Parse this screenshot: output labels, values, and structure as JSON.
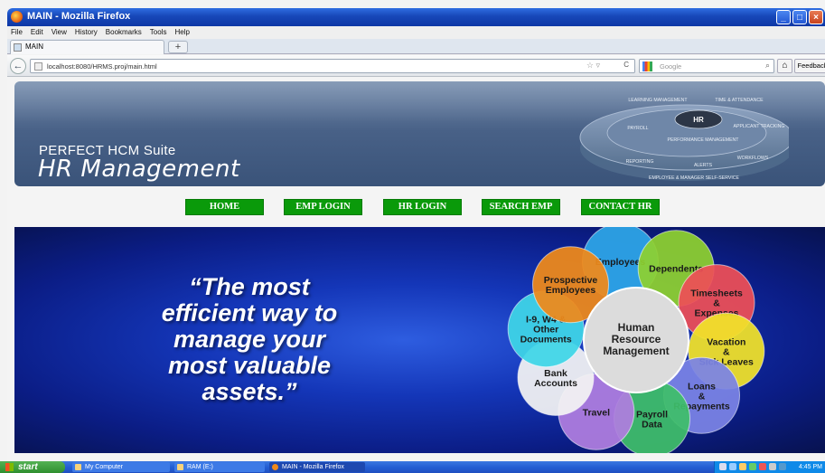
{
  "window": {
    "title": "MAIN - Mozilla Firefox",
    "controls": {
      "minimize": "_",
      "maximize": "□",
      "close": "×"
    }
  },
  "menubar": [
    "File",
    "Edit",
    "View",
    "History",
    "Bookmarks",
    "Tools",
    "Help"
  ],
  "tabs": [
    {
      "label": "MAIN"
    }
  ],
  "newtab_label": "+",
  "navbar": {
    "back": "←",
    "url": "localhost:8080/HRMS.proj/main.html",
    "star": "☆ ▿",
    "reload": "C",
    "search_placeholder": "Google",
    "search_icon": "⌕",
    "home": "⌂",
    "feedback": "Feedback"
  },
  "banner": {
    "suite": "PERFECT HCM Suite",
    "title": "HR Management",
    "wheel": {
      "center": "HR",
      "segments": [
        "LEARNING MANAGEMENT",
        "TIME & ATTENDANCE",
        "PAYROLL",
        "APPLICANT TRACKING",
        "PERFORMANCE MANAGEMENT",
        "REPORTING",
        "ALERTS",
        "WORKFLOWS",
        "EMPLOYEE & MANAGER SELF-SERVICE"
      ]
    }
  },
  "nav_menu": [
    "HOME",
    "EMP LOGIN",
    "HR LOGIN",
    "SEARCH EMP",
    "CONTACT HR"
  ],
  "hero": {
    "quote_lines": [
      "“The most",
      "efficient way to",
      "manage your",
      "most valuable",
      "assets.”"
    ]
  },
  "diagram": {
    "center_lines": [
      "Human",
      "Resource",
      "Management"
    ],
    "petals": [
      {
        "lines": [
          "Employees"
        ],
        "color": "#2ea6e8"
      },
      {
        "lines": [
          "Dependents"
        ],
        "color": "#8fd130"
      },
      {
        "lines": [
          "Timesheets",
          "&",
          "Expenses"
        ],
        "color": "#ee4f57"
      },
      {
        "lines": [
          "Vacation",
          "&",
          "Sick Leaves"
        ],
        "color": "#f2e32a"
      },
      {
        "lines": [
          "Loans",
          "&",
          "Repayments"
        ],
        "color": "#7b84e6"
      },
      {
        "lines": [
          "Payroll",
          "Data"
        ],
        "color": "#3fbf6a"
      },
      {
        "lines": [
          "Travel"
        ],
        "color": "#b07ee0"
      },
      {
        "lines": [
          "Bank",
          "Accounts"
        ],
        "color": "#f4f4f4"
      },
      {
        "lines": [
          "I-9, W4 &",
          "Other",
          "Documents"
        ],
        "color": "#3fd6e8"
      },
      {
        "lines": [
          "Prospective",
          "Employees"
        ],
        "color": "#f08a1a"
      }
    ]
  },
  "taskbar": {
    "start": "start",
    "tasks": [
      "My Computer",
      "RAM (E:)",
      "MAIN - Mozilla Firefox"
    ],
    "clock": "4:45 PM"
  }
}
